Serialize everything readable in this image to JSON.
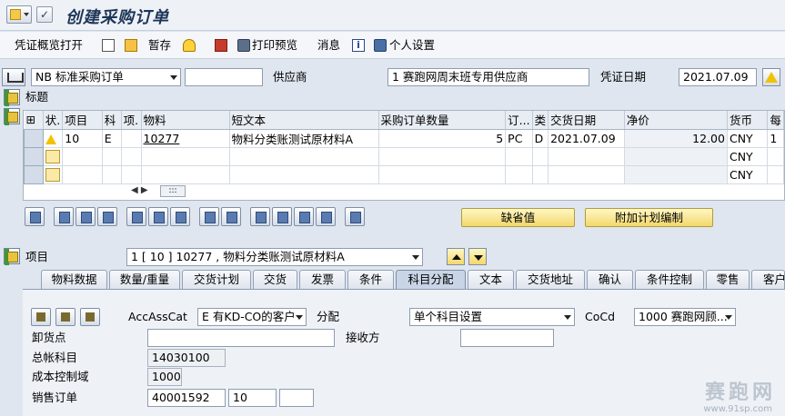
{
  "window": {
    "title": "创建采购订单"
  },
  "toolbar": {
    "voucher_overview": "凭证概览打开",
    "hold": "暂存",
    "print_preview": "打印预览",
    "messages": "消息",
    "personal_settings": "个人设置"
  },
  "header": {
    "order_type": "NB 标准采购订单",
    "vendor_label": "供应商",
    "vendor_value": "1 赛跑网周末班专用供应商",
    "doc_date_label": "凭证日期",
    "doc_date_value": "2021.07.09"
  },
  "sections": {
    "header_title": "标题"
  },
  "grid": {
    "columns": [
      "状.",
      "项目",
      "科",
      "项.",
      "物料",
      "短文本",
      "采购订单数量",
      "订...",
      "类",
      "交货日期",
      "净价",
      "货币",
      "每"
    ],
    "rows": [
      {
        "item": "10",
        "acct": "E",
        "material": "10277",
        "short_text": "物料分类账测试原材料A",
        "qty": "5",
        "unit": "PC",
        "cat": "D",
        "delivery_date": "2021.07.09",
        "net_price": "12.00",
        "currency": "CNY",
        "per": "1"
      },
      {
        "currency": "CNY"
      },
      {
        "currency": "CNY"
      }
    ]
  },
  "buttons": {
    "default_values": "缺省值",
    "additional_planning": "附加计划编制"
  },
  "item_nav": {
    "label": "项目",
    "value": "1 [ 10 ] 10277 , 物料分类账测试原材料A"
  },
  "tabs": [
    "物料数据",
    "数量/重量",
    "交货计划",
    "交货",
    "发票",
    "条件",
    "科目分配",
    "文本",
    "交货地址",
    "确认",
    "条件控制",
    "零售",
    "客户"
  ],
  "active_tab": "科目分配",
  "account_assignment": {
    "acc_ass_cat_label": "AccAssCat",
    "acc_ass_cat_value": "E 有KD-CO的客户",
    "distribution_label": "分配",
    "distribution_value": "单个科目设置",
    "coco_label": "CoCd",
    "coco_value": "1000 赛跑网顾...",
    "unloading_point_label": "卸货点",
    "unloading_point_value": "",
    "recipient_label": "接收方",
    "recipient_value": "",
    "gl_account_label": "总帐科目",
    "gl_account_value": "14030100",
    "co_area_label": "成本控制域",
    "co_area_value": "1000",
    "sales_order_label": "销售订单",
    "sales_order_value": "40001592",
    "sales_order_item": "10",
    "sales_order_extra": ""
  },
  "watermark": {
    "text": "赛跑网",
    "url": "www.91sp.com"
  }
}
